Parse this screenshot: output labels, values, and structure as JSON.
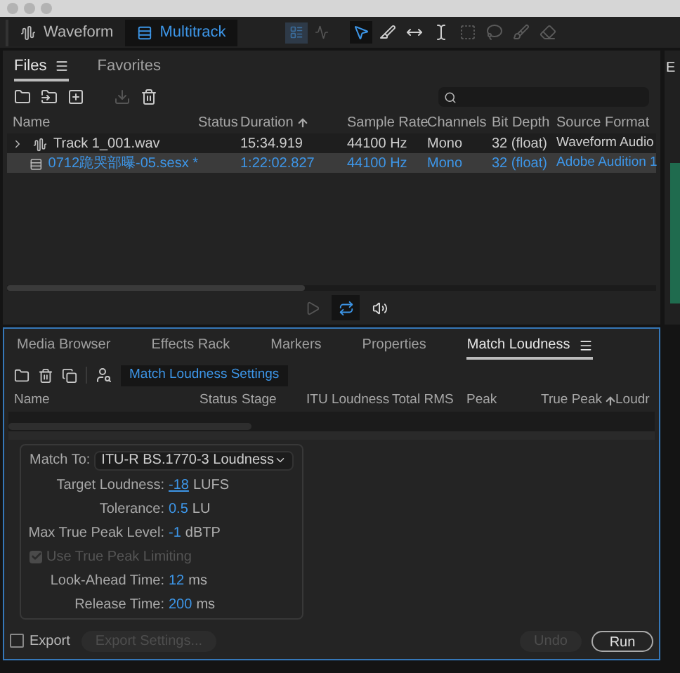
{
  "workspace_tabs": [
    {
      "label": "Waveform",
      "selected": false
    },
    {
      "label": "Multitrack",
      "selected": true
    }
  ],
  "view_buttons": [
    {
      "kind": "editor",
      "selected": true
    },
    {
      "kind": "spectral",
      "selected": false
    }
  ],
  "tools": [
    {
      "kind": "move",
      "selected": true
    },
    {
      "kind": "razor",
      "selected": false
    },
    {
      "kind": "slip",
      "selected": false
    },
    {
      "kind": "time",
      "selected": false
    },
    {
      "kind": "marquee",
      "selected": false
    },
    {
      "kind": "lasso",
      "selected": false
    },
    {
      "kind": "brush",
      "selected": false
    },
    {
      "kind": "heal",
      "selected": false
    }
  ],
  "files_panel": {
    "tabs": [
      {
        "label": "Files",
        "selected": true
      },
      {
        "label": "Favorites",
        "selected": false
      }
    ],
    "actions": [
      {
        "kind": "open",
        "disabled": false
      },
      {
        "kind": "import",
        "disabled": false
      },
      {
        "kind": "new",
        "disabled": false
      },
      {
        "kind": "insert",
        "disabled": true
      },
      {
        "kind": "delete",
        "disabled": false
      }
    ],
    "columns": [
      {
        "label": "Name",
        "sorted": false
      },
      {
        "label": "Status",
        "sorted": false
      },
      {
        "label": "Duration",
        "sorted": true
      },
      {
        "label": "Sample Rate",
        "sorted": false
      },
      {
        "label": "Channels",
        "sorted": false
      },
      {
        "label": "Bit Depth",
        "sorted": false
      },
      {
        "label": "Source Format",
        "sorted": false
      }
    ],
    "rows": [
      {
        "kind": "audio",
        "expandable": true,
        "selected": false,
        "name": "Track 1_001.wav",
        "duration": "15:34.919",
        "sample_rate": "44100 Hz",
        "channels": "Mono",
        "bit_depth": "32 (float)",
        "source_format": "Waveform Audio"
      },
      {
        "kind": "session",
        "expandable": false,
        "selected": true,
        "name": "0712跪哭部曝-05.sesx *",
        "duration": "1:22:02.827",
        "sample_rate": "44100 Hz",
        "channels": "Mono",
        "bit_depth": "32 (float)",
        "source_format": "Adobe Audition 1"
      }
    ]
  },
  "transport": [
    {
      "kind": "play",
      "selected": false
    },
    {
      "kind": "loop",
      "selected": true
    },
    {
      "kind": "speaker",
      "selected": false
    }
  ],
  "bottom_panel": {
    "tabs": [
      {
        "label": "Media Browser",
        "selected": false
      },
      {
        "label": "Effects Rack",
        "selected": false
      },
      {
        "label": "Markers",
        "selected": false
      },
      {
        "label": "Properties",
        "selected": false
      },
      {
        "label": "Match Loudness",
        "selected": true
      }
    ],
    "settings_button": "Match Loudness Settings",
    "columns": [
      {
        "label": "Name",
        "sorted": false
      },
      {
        "label": "Status",
        "sorted": false
      },
      {
        "label": "Stage",
        "sorted": false
      },
      {
        "label": "ITU Loudness",
        "sorted": false
      },
      {
        "label": "Total RMS",
        "sorted": false
      },
      {
        "label": "Peak",
        "sorted": false
      },
      {
        "label": "True Peak",
        "sorted": true
      },
      {
        "label": "Loudr",
        "sorted": false
      }
    ],
    "match_to": {
      "label": "Match To:",
      "value": "ITU-R BS.1770-3 Loudness"
    },
    "fields": [
      {
        "kind": "value",
        "label": "Target Loudness:",
        "value": "-18",
        "unit": "LUFS",
        "focused": true
      },
      {
        "kind": "value",
        "label": "Tolerance:",
        "value": "0.5",
        "unit": "LU",
        "focused": false
      },
      {
        "kind": "value",
        "label": "Max True Peak Level:",
        "value": "-1",
        "unit": "dBTP",
        "focused": false
      },
      {
        "kind": "checkbox",
        "label": "Use True Peak Limiting",
        "checked": true,
        "disabled": true
      },
      {
        "kind": "value",
        "label": "Look-Ahead Time:",
        "value": "12",
        "unit": "ms",
        "focused": false
      },
      {
        "kind": "value",
        "label": "Release Time:",
        "value": "200",
        "unit": "ms",
        "focused": false
      }
    ],
    "export": {
      "label": "Export",
      "checked": false
    },
    "buttons": [
      {
        "kind": "export_settings",
        "label": "Export Settings...",
        "disabled": true
      },
      {
        "kind": "undo",
        "label": "Undo",
        "disabled": true
      },
      {
        "kind": "run",
        "label": "Run",
        "disabled": false
      }
    ]
  },
  "right_panel": {
    "tab_label": "E"
  }
}
